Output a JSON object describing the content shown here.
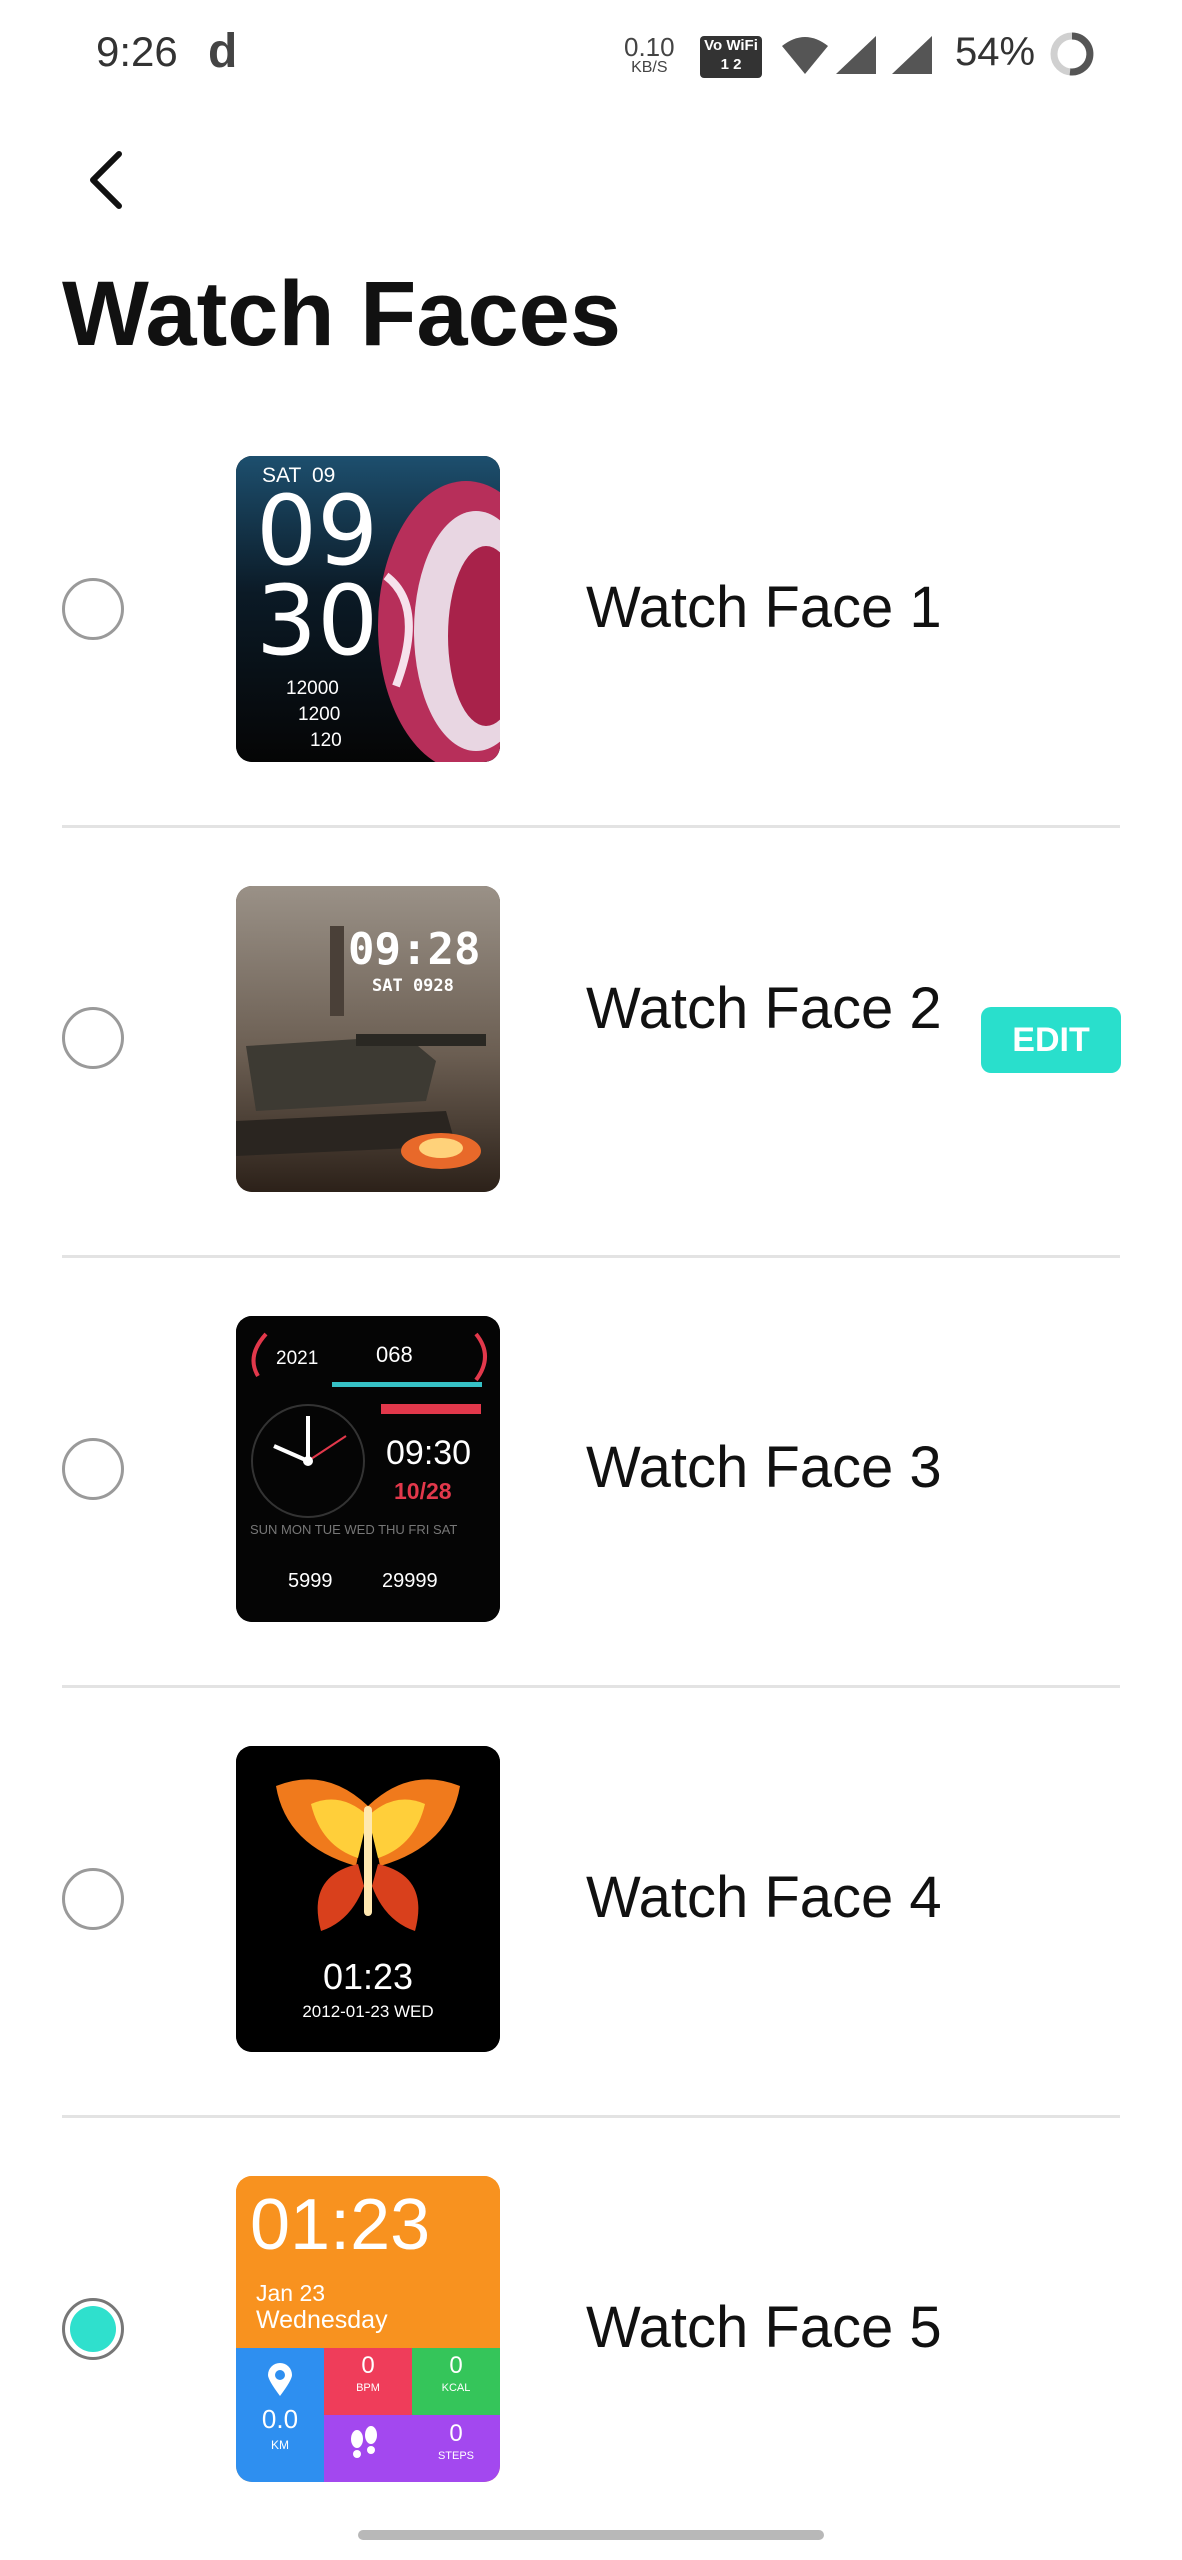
{
  "status_bar": {
    "time": "9:26",
    "app_indicator": "d",
    "net_speed_value": "0.10",
    "net_speed_unit": "KB/S",
    "vowifi_label": "Vo WiFi",
    "vowifi_sub": "1 2",
    "battery": "54%",
    "icons": [
      "wifi-icon",
      "signal-icon",
      "signal-icon",
      "battery-ring-icon"
    ]
  },
  "header": {
    "back_icon": "chevron-left-icon",
    "title": "Watch Faces"
  },
  "edit_label": "EDIT",
  "faces": [
    {
      "label": "Watch Face 1",
      "selected": false,
      "preview": {
        "day": "SAT",
        "date": "09",
        "hour": "09",
        "minute": "30",
        "steps": "12000",
        "calories": "1200",
        "heart": "120"
      }
    },
    {
      "label": "Watch Face 2",
      "selected": false,
      "editable": true,
      "preview": {
        "time": "09:28",
        "day_date": "SAT 0928"
      }
    },
    {
      "label": "Watch Face 3",
      "selected": false,
      "preview": {
        "year": "2021",
        "heart": "068",
        "time": "09:30",
        "date": "10/28",
        "days": "SUN MON TUE WED THU FRI SAT",
        "calories": "5999",
        "steps": "29999"
      }
    },
    {
      "label": "Watch Face 4",
      "selected": false,
      "preview": {
        "time": "01:23",
        "date": "2012-01-23 WED"
      }
    },
    {
      "label": "Watch Face 5",
      "selected": true,
      "preview": {
        "time": "01:23",
        "date": "Jan 23",
        "weekday": "Wednesday",
        "distance": "0.0",
        "distance_unit": "KM",
        "bpm": "0",
        "bpm_unit": "BPM",
        "kcal": "0",
        "kcal_unit": "KCAL",
        "steps": "0",
        "steps_unit": "STEPS"
      }
    }
  ],
  "colors": {
    "accent": "#29dfcc",
    "text": "#111111",
    "divider": "#e3e3e3"
  }
}
